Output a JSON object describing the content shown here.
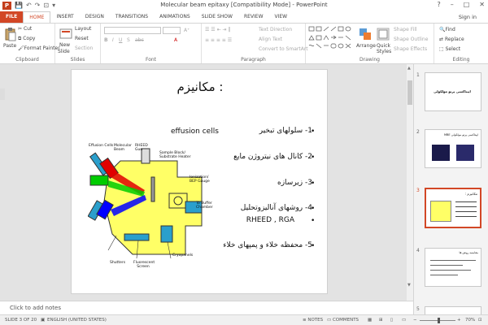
{
  "window": {
    "title": "Molecular beam epitaxy [Compatibility Mode] - PowerPoint",
    "app_icon": "P",
    "help": "?",
    "minimize": "–",
    "restore": "□",
    "close": "✕"
  },
  "qat": {
    "save": "💾",
    "undo": "↶",
    "redo": "↷",
    "present": "⊡",
    "more": "▾"
  },
  "tabs": [
    "FILE",
    "HOME",
    "INSERT",
    "DESIGN",
    "TRANSITIONS",
    "ANIMATIONS",
    "SLIDE SHOW",
    "REVIEW",
    "VIEW"
  ],
  "account": {
    "signin": "Sign in"
  },
  "ribbon": {
    "clipboard": {
      "paste": "Paste",
      "cut": "Cut",
      "copy": "Copy",
      "format_painter": "Format Painter",
      "label": "Clipboard"
    },
    "slides": {
      "new_slide": "New",
      "new_slide2": "Slide",
      "layout": "Layout",
      "reset": "Reset",
      "section": "Section",
      "label": "Slides"
    },
    "font": {
      "label": "Font",
      "font_value": "",
      "size_value": ""
    },
    "paragraph": {
      "label": "Paragraph",
      "text_direction": "Text Direction",
      "align_text": "Align Text",
      "convert": "Convert to SmartArt"
    },
    "drawing": {
      "label": "Drawing",
      "arrange": "Arrange",
      "quick_styles": "Quick",
      "quick_styles2": "Styles",
      "fill": "Shape Fill",
      "outline": "Shape Outline",
      "effects": "Shape Effects"
    },
    "editing": {
      "label": "Editing",
      "find": "Find",
      "replace": "Replace",
      "select": "Select"
    }
  },
  "slide": {
    "title": "مکانیزم :",
    "effusion": "effusion cells",
    "bullets": [
      "1- سلولهای تبخیر",
      "2- کانال های نیتروژن مایع",
      "3- زیرسازه",
      "4- روشهای آنالیزوتحلیل",
      "RHEED  ,  RGA",
      "5- محفظه خلاء و پمپهای خلاء"
    ],
    "diagram_labels": {
      "effusion_cells": "Effusion Cells",
      "molecular_beam": "Molecular Beam",
      "rheed_gun": "RHEED Gun",
      "sample_block": "Sample Block/ Substrate Heater",
      "ionization": "Ionization/ BEP Gauge",
      "buffer": "To Buffer Chamber",
      "shutters": "Shutters",
      "screen": "Fluorescent Screen",
      "cryopanels": "Cryopanels"
    }
  },
  "notes": {
    "placeholder": "Click to add notes"
  },
  "thumbnails": [
    {
      "num": "1",
      "title": "اپیتاکسی پرتو مولکولی"
    },
    {
      "num": "2",
      "title": "اپیتاکسی پرتو مولکولی MBE"
    },
    {
      "num": "3",
      "title": "مکانیزم :"
    },
    {
      "num": "4",
      "title": "مقایسه روش ها"
    },
    {
      "num": "5",
      "title": ""
    }
  ],
  "status": {
    "slide": "SLIDE 3 OF 20",
    "language": "ENGLISH (UNITED STATES)",
    "notes": "NOTES",
    "comments": "COMMENTS",
    "zoom": "70%",
    "zoom_level": 0.7
  },
  "colors": {
    "accent": "#d24726",
    "chamber_fill": "#ffff66",
    "cell_red": "#e00000",
    "cell_green": "#00cc00",
    "cell_blue": "#0000ff",
    "cryo_fill": "#33aacc"
  }
}
